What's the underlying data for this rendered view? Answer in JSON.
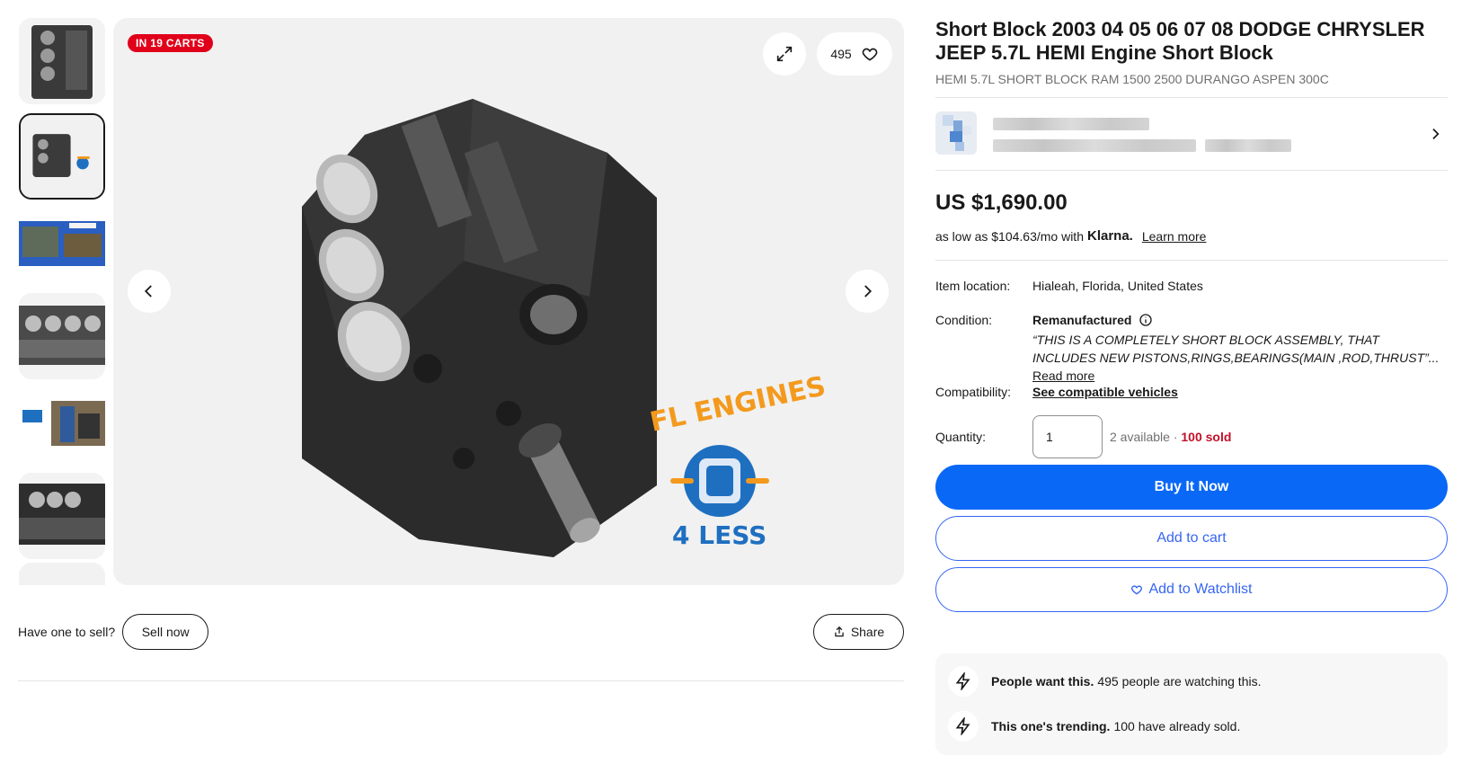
{
  "gallery": {
    "badge": "IN 19 CARTS",
    "watch_count": "495",
    "logo_top": "FL ENGINES",
    "logo_bottom": "4 LESS"
  },
  "thumbnails": [
    {
      "name": "engine-block-top"
    },
    {
      "name": "engine-block-logo"
    },
    {
      "name": "promo-banner"
    },
    {
      "name": "cylinder-bores"
    },
    {
      "name": "assembly-shop"
    },
    {
      "name": "pistons-closeup"
    }
  ],
  "below_gallery": {
    "sell_label": "Have one to sell?",
    "sell_button": "Sell now",
    "share_button": "Share"
  },
  "listing": {
    "title": "Short Block 2003 04 05 06 07 08 DODGE CHRYSLER JEEP 5.7L HEMI Engine Short Block",
    "subtitle": "HEMI 5.7L SHORT BLOCK RAM 1500 2500 DURANGO ASPEN 300C",
    "price": "US $1,690.00",
    "klarna_prefix": "as low as $104.63/mo with",
    "klarna_brand": "Klarna.",
    "klarna_link": "Learn more"
  },
  "specs": {
    "location_label": "Item location:",
    "location_value": "Hialeah, Florida, United States",
    "condition_label": "Condition:",
    "condition_value": "Remanufactured",
    "condition_desc": "“THIS IS A COMPLETELY SHORT BLOCK ASSEMBLY, THAT INCLUDES NEW PISTONS,RINGS,BEARINGS(MAIN ,ROD,THRUST”...",
    "read_more": "Read more",
    "compat_label": "Compatibility:",
    "compat_link": "See compatible vehicles",
    "qty_label": "Quantity:",
    "qty_value": "1",
    "available": "2 available ·",
    "sold": "100 sold"
  },
  "actions": {
    "buy_now": "Buy It Now",
    "add_cart": "Add to cart",
    "watchlist": "Add to Watchlist"
  },
  "signals": [
    {
      "bold": "People want this.",
      "text": "495 people are watching this."
    },
    {
      "bold": "This one's trending.",
      "text": "100 have already sold."
    }
  ],
  "colors": {
    "accent_blue": "#3665f3",
    "buy_blue": "#0968f6",
    "badge_red": "#e0001a",
    "sold_red": "#c2102a",
    "logo_orange": "#f39a1e",
    "logo_blue": "#1f6fc0"
  }
}
